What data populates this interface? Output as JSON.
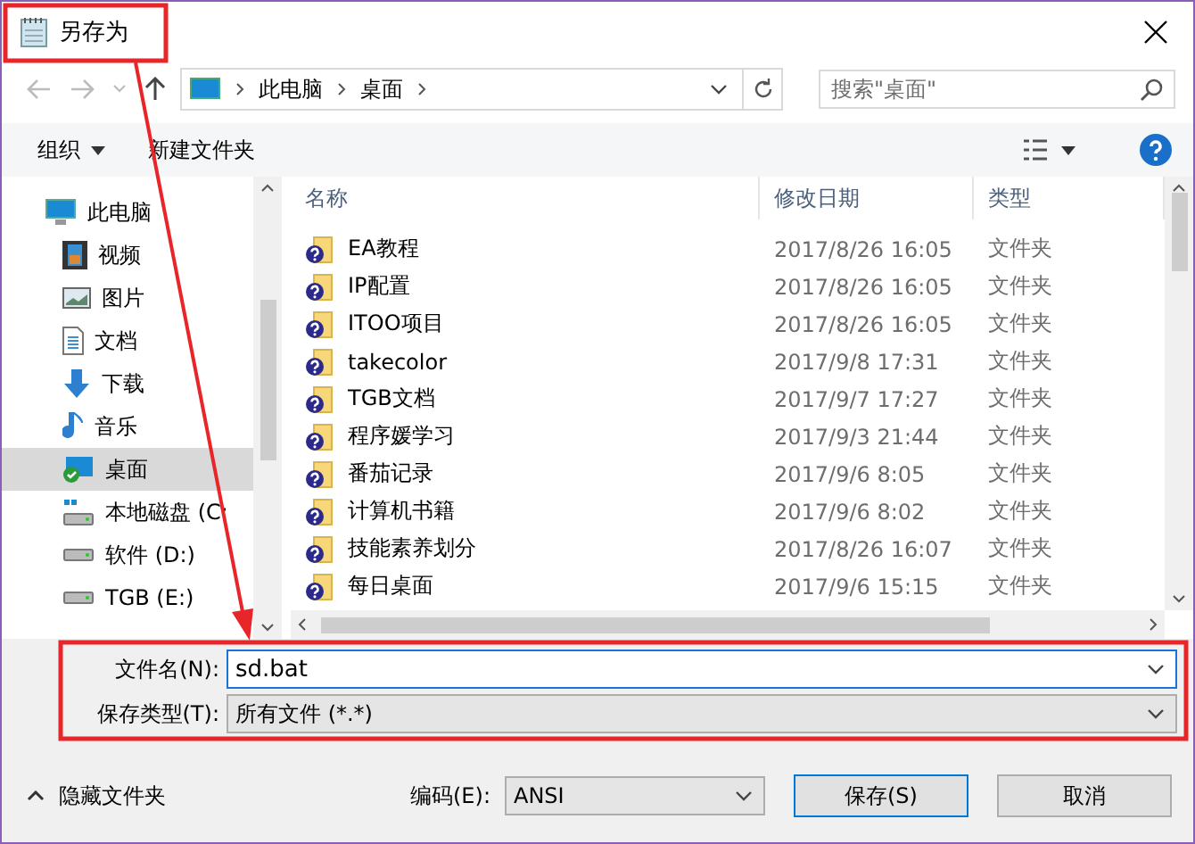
{
  "window": {
    "title": "另存为"
  },
  "address": {
    "path": [
      "此电脑",
      "桌面"
    ]
  },
  "search": {
    "placeholder": "搜索\"桌面\""
  },
  "toolbar": {
    "organize": "组织",
    "new_folder": "新建文件夹"
  },
  "sidebar": {
    "items": [
      {
        "label": "此电脑",
        "kind": "pc",
        "selected": false,
        "children": [
          {
            "label": "视频",
            "kind": "video",
            "selected": false
          },
          {
            "label": "图片",
            "kind": "picture",
            "selected": false
          },
          {
            "label": "文档",
            "kind": "document",
            "selected": false
          },
          {
            "label": "下载",
            "kind": "download",
            "selected": false
          },
          {
            "label": "音乐",
            "kind": "music",
            "selected": false
          },
          {
            "label": "桌面",
            "kind": "desktop",
            "selected": true
          },
          {
            "label": "本地磁盘 (C:",
            "kind": "system-drive",
            "selected": false
          },
          {
            "label": "软件 (D:)",
            "kind": "drive",
            "selected": false
          },
          {
            "label": "TGB (E:)",
            "kind": "drive",
            "selected": false
          }
        ]
      }
    ]
  },
  "table": {
    "columns": [
      "名称",
      "修改日期",
      "类型"
    ],
    "rows": [
      {
        "name": "EA教程",
        "date": "2017/8/26 16:05",
        "type": "文件夹"
      },
      {
        "name": "IP配置",
        "date": "2017/8/26 16:05",
        "type": "文件夹"
      },
      {
        "name": "ITOO项目",
        "date": "2017/8/26 16:05",
        "type": "文件夹"
      },
      {
        "name": "takecolor",
        "date": "2017/9/8 17:31",
        "type": "文件夹"
      },
      {
        "name": "TGB文档",
        "date": "2017/9/7 17:27",
        "type": "文件夹"
      },
      {
        "name": "程序媛学习",
        "date": "2017/9/3 21:44",
        "type": "文件夹"
      },
      {
        "name": "番茄记录",
        "date": "2017/9/6 8:05",
        "type": "文件夹"
      },
      {
        "name": "计算机书籍",
        "date": "2017/9/6 8:02",
        "type": "文件夹"
      },
      {
        "name": "技能素养划分",
        "date": "2017/8/26 16:07",
        "type": "文件夹"
      },
      {
        "name": "每日桌面",
        "date": "2017/9/6 15:15",
        "type": "文件夹"
      }
    ]
  },
  "form": {
    "filename_label": "文件名(N):",
    "filename": "sd.bat",
    "type_label": "保存类型(T):",
    "type": "所有文件 (*.*)"
  },
  "footer": {
    "hide_folders": "隐藏文件夹",
    "encoding_label": "编码(E):",
    "encoding": "ANSI",
    "save": "保存(S)",
    "cancel": "取消"
  }
}
